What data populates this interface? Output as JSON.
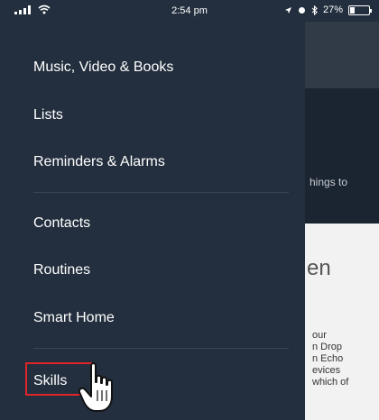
{
  "status_bar": {
    "time": "2:54 pm",
    "battery_percent": "27%",
    "battery_level": 0.27
  },
  "background_page": {
    "snippet": "hings to",
    "heading": "en",
    "paragraph_lines": [
      "our",
      "n Drop",
      "n Echo",
      "evices",
      "which of"
    ]
  },
  "menu": {
    "items": [
      {
        "label": "Music, Video & Books"
      },
      {
        "label": "Lists"
      },
      {
        "label": "Reminders & Alarms"
      },
      {
        "label": "Contacts"
      },
      {
        "label": "Routines"
      },
      {
        "label": "Smart Home"
      },
      {
        "label": "Skills"
      }
    ]
  },
  "colors": {
    "drawer": "#232f3e",
    "highlight": "#e0252a"
  }
}
